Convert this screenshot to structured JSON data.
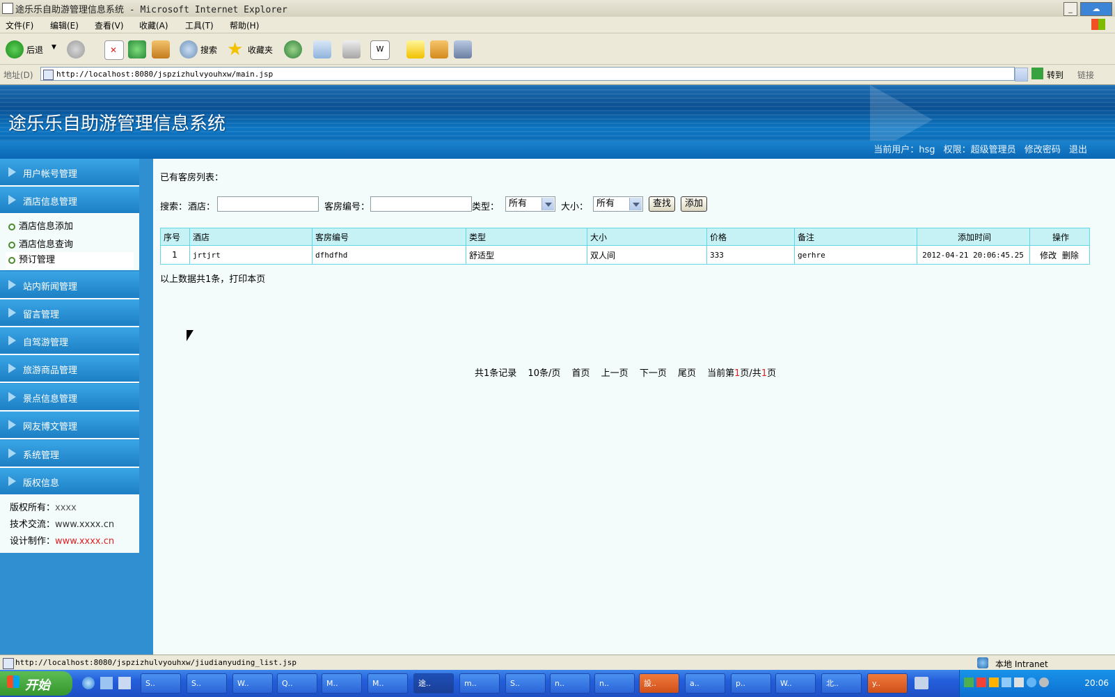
{
  "window": {
    "title": "途乐乐自助游管理信息系统 - Microsoft Internet Explorer"
  },
  "menu": [
    "文件(F)",
    "编辑(E)",
    "查看(V)",
    "收藏(A)",
    "工具(T)",
    "帮助(H)"
  ],
  "toolbar": {
    "back": "后退",
    "search": "搜索",
    "favorites": "收藏夹"
  },
  "address": {
    "label": "地址(D)",
    "url": "http://localhost:8080/jspzizhulvyouhxw/main.jsp",
    "go": "转到",
    "links": "链接"
  },
  "header": {
    "title": "途乐乐自助游管理信息系统",
    "user_label": "当前用户：hsg",
    "perm_label": "权限：超级管理员",
    "change_pwd": "修改密码",
    "logout": "退出"
  },
  "sidebar": {
    "items": [
      "用户帐号管理",
      "酒店信息管理",
      "站内新闻管理",
      "留言管理",
      "自驾游管理",
      "旅游商品管理",
      "景点信息管理",
      "网友博文管理",
      "系统管理",
      "版权信息"
    ],
    "sub_items": [
      "酒店信息添加",
      "酒店信息查询",
      "预订管理"
    ],
    "copyright": {
      "owner_label": "版权所有：",
      "owner": "xxxx",
      "tech_label": "技术交流：",
      "tech": "www.xxxx.cn",
      "design_label": "设计制作：",
      "design": "www.xxxx.cn"
    }
  },
  "main": {
    "list_title": "已有客房列表：",
    "search": {
      "label": "搜索：",
      "hotel_label": "酒店：",
      "hotel_value": "",
      "room_no_label": "客房编号：",
      "room_no_value": "",
      "type_label": "类型：",
      "type_value": "所有",
      "size_label": "大小：",
      "size_value": "所有",
      "find_button": "查找",
      "add_button": "添加"
    },
    "table": {
      "headers": [
        "序号",
        "酒店",
        "客房编号",
        "类型",
        "大小",
        "价格",
        "备注",
        "添加时间",
        "操作"
      ],
      "rows": [
        {
          "no": "1",
          "hotel": "jrtjrt",
          "room_no": "dfhdfhd",
          "type": "舒适型",
          "size": "双人间",
          "price": "333",
          "note": "gerhre",
          "time": "2012-04-21 20:06:45.25",
          "edit": "修改",
          "delete": "删除"
        }
      ]
    },
    "summary": "以上数据共1条，打印本页",
    "pager": {
      "total": "共1条记录",
      "per_page": "10条/页",
      "first": "首页",
      "prev": "上一页",
      "next": "下一页",
      "last": "尾页",
      "current_pre": "当前第",
      "current": "1",
      "current_mid": "页/共",
      "total_pages": "1",
      "current_post": "页"
    }
  },
  "status": {
    "url": "http://localhost:8080/jspzizhulvyouhxw/jiudianyuding_list.jsp",
    "zone": "本地 Intranet"
  },
  "taskbar": {
    "start": "开始",
    "tasks": [
      "S..",
      "S..",
      "W..",
      "Q..",
      "M..",
      "M..",
      "途..",
      "m..",
      "S..",
      "n..",
      "n..",
      "設..",
      "a..",
      "p..",
      "W..",
      "北..",
      "y.."
    ],
    "clock": "20:06"
  },
  "colors": {
    "banner": "#0a5ea6",
    "sidebar": "#2f8fd0",
    "table_border": "#5fd7e6",
    "table_header": "#c6f2f6",
    "accent_red": "#e02020"
  }
}
